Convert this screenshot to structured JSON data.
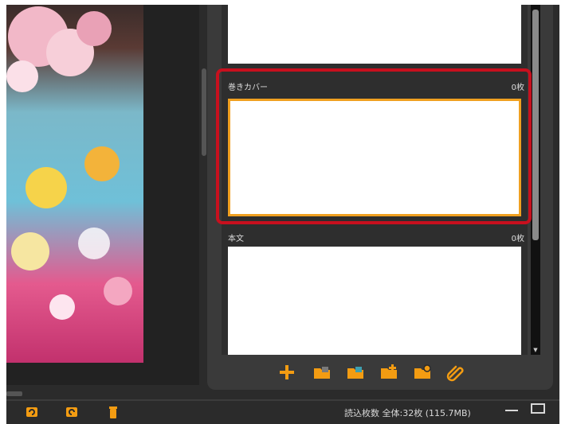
{
  "sections": [
    {
      "title": "巻きカバー",
      "count": "0枚"
    },
    {
      "title": "本文",
      "count": "0枚"
    }
  ],
  "toolbar": {
    "icons": [
      "plus-icon",
      "folder-image-icon",
      "folder-photo-icon",
      "folder-add-icon",
      "folder-settings-icon",
      "paperclip-icon"
    ]
  },
  "statusbar": {
    "icons": [
      "rotate-left-icon",
      "rotate-right-icon",
      "trash-icon"
    ],
    "summary": "読込枚数 全体:32枚 (115.7MB)"
  },
  "colors": {
    "accent": "#f39c12",
    "highlight": "#c8101e",
    "selected_border": "#f0a020"
  }
}
